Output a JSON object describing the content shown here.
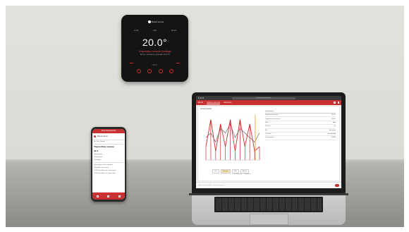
{
  "thermostat": {
    "brand": "Bosch Home",
    "status_icons": [
      "wifi-icon",
      "mode-icon",
      "schedule-icon"
    ],
    "status_labels": [
      "pt 5s",
      "A/S",
      "10:15"
    ],
    "temperature": "20.0°",
    "subtitle": "Température courante chauffage",
    "subtitle2": "Temp. ambiante actuelle 21,0°C",
    "menu_label": "MENU"
  },
  "phone": {
    "status_bar": "Bosch EasyControl",
    "header": "Bosch Home",
    "device_name": "Mr. Jean Dupont",
    "title": "Thermoflow, maison",
    "value": "31 A",
    "rows": [
      "Informations",
      "Temperature",
      "Chauffage"
    ],
    "lines": [
      "Information sur le calendrier",
      "Chaudière en marche",
      "12:40 Chaudière ok / fonctionnel",
      "10:30 Chaudière en route / prêt"
    ]
  },
  "laptop": {
    "url": "bosch-easycontrol.com",
    "brand": "Bosch",
    "tabs": [
      "Tableau de bord",
      "Historique"
    ],
    "panel_title": "Consommation",
    "legend": [
      "Jour",
      "Semaine",
      "Mois",
      "Année"
    ],
    "legend_sub": [
      "Consommation",
      "Température"
    ],
    "table_title": "Informations",
    "table_rows": [
      {
        "k": "Température ambiante",
        "v": "21,0°C"
      },
      {
        "k": "Température de consigne",
        "v": "20,0°C"
      },
      {
        "k": "Mode",
        "v": "Auto"
      },
      {
        "k": "Pression",
        "v": "1,5"
      },
      {
        "k": "État",
        "v": "En marche"
      },
      {
        "k": "Chaudière",
        "v": "Fonctionnelle"
      },
      {
        "k": "Consommation",
        "v": "12 kWh"
      }
    ],
    "footer": "Robert Bosch GmbH — Mentions légales"
  },
  "chart_data": {
    "type": "line",
    "title": "",
    "series": [
      {
        "values": [
          5,
          6,
          4,
          7,
          6,
          8,
          5,
          7,
          6,
          5,
          4,
          6
        ]
      },
      {
        "values": [
          3,
          9,
          2,
          8,
          3,
          9,
          2,
          9,
          3,
          8,
          2,
          3
        ]
      }
    ],
    "colors": {
      "primary": "#c8312f",
      "secondary": "#555555",
      "highlight": "#e8a23a"
    }
  },
  "colors": {
    "brand": "#c8312f",
    "wall": "#e0ded9",
    "floor": "#a8a6a1"
  }
}
